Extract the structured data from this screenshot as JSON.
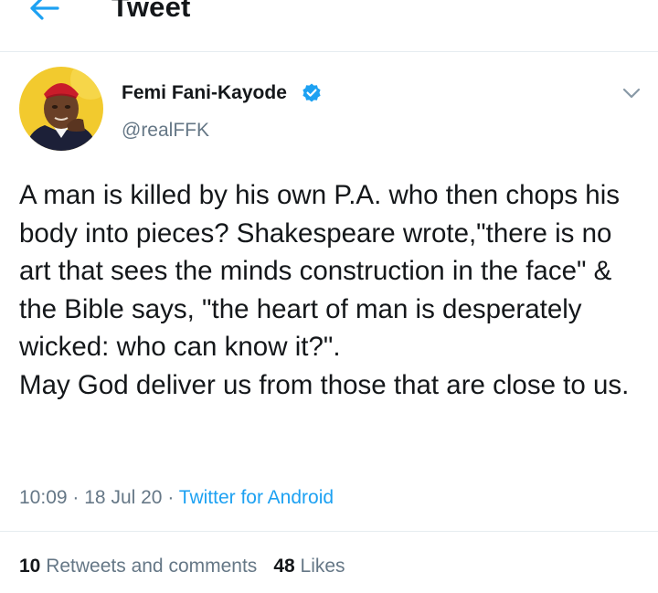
{
  "header": {
    "title": "Tweet",
    "back_icon": "arrow-left-icon"
  },
  "author": {
    "display_name": "Femi Fani-Kayode",
    "handle": "@realFFK",
    "verified_icon": "verified-badge-icon"
  },
  "tweet": {
    "text": "A man is killed by his own P.A. who then chops his body into pieces? Shakespeare wrote,\"there is no art that sees the minds construction in the face\" & the Bible says, \"the heart of man is desperately wicked: who can know it?\".\nMay God deliver us from those that are close to us.",
    "time": "10:09",
    "date": "18 Jul 20",
    "source": "Twitter for Android",
    "separator": "·"
  },
  "stats": {
    "retweets_count": "10",
    "retweets_label": "Retweets and comments",
    "likes_count": "48",
    "likes_label": "Likes"
  },
  "colors": {
    "accent": "#1da1f2",
    "text": "#14171a",
    "muted": "#657786",
    "divider": "#e6ecf0"
  }
}
